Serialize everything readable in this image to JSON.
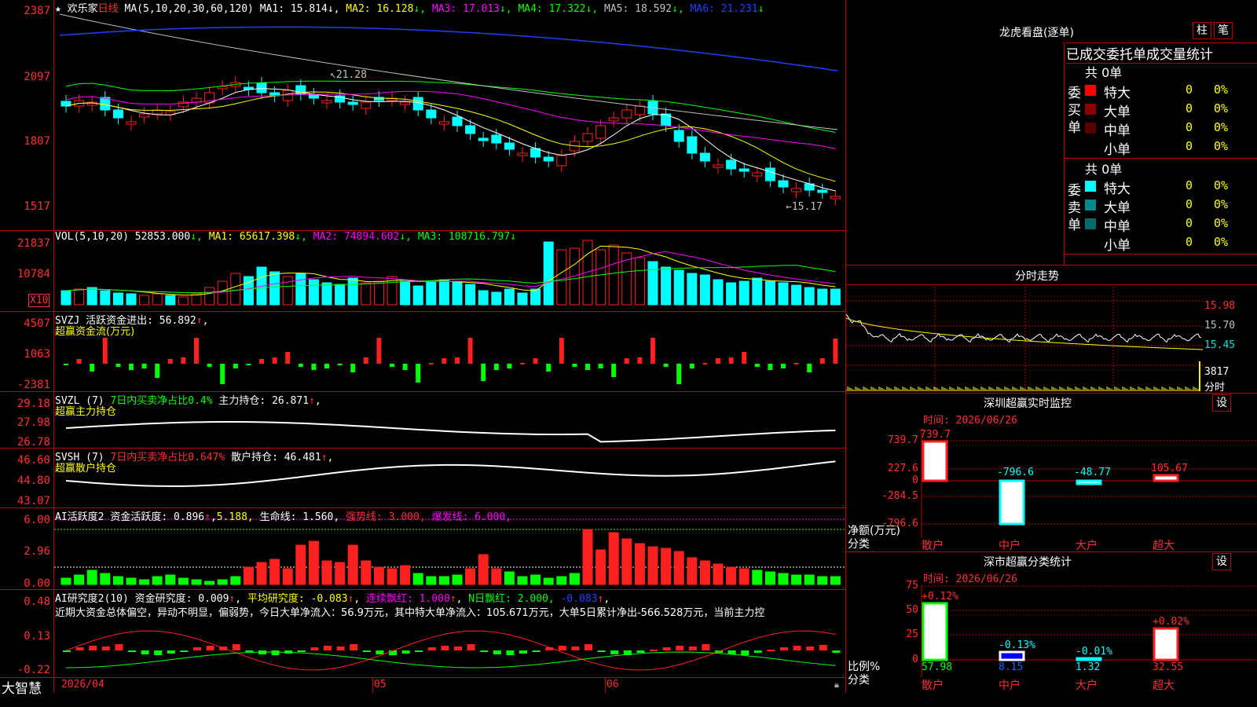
{
  "header": {
    "stock": "欢乐家",
    "period": "日线",
    "ma_label": "MA(5,10,20,30,60,120)",
    "ma1": "MA1: 15.814",
    "ma2": "MA2: 16.128",
    "ma3": "MA3: 17.013",
    "ma4": "MA4: 17.322",
    "ma5": "MA5: 18.592",
    "ma6": "MA6: 21.231",
    "hi_annot": "21.28",
    "lo_annot": "15.17"
  },
  "price_axis": [
    "2387",
    "2097",
    "1807",
    "1517"
  ],
  "vol": {
    "label": "VOL(5,10,20)",
    "value": "52853.000",
    "ma1": "MA1: 65617.398",
    "ma2": "MA2: 74894.602",
    "ma3": "MA3: 108716.797",
    "axis": [
      "21837",
      "10784"
    ],
    "unit": "X10"
  },
  "svzj": {
    "l1a": "SVZJ",
    "l1b": "活跃资金进出: 56.892",
    "l2": "超赢资金流(万元)",
    "axis": [
      "4507",
      "1063",
      "-2381"
    ]
  },
  "svzl": {
    "l1a": "SVZL (7)",
    "l1b": "7日内买卖净占比0.4%",
    "l1c": "主力持仓: 26.871",
    "l2": "超赢主力持仓",
    "axis": [
      "29.18",
      "27.98",
      "26.78"
    ]
  },
  "svsh": {
    "l1a": "SVSH (7)",
    "l1b": "7日内买卖净占比0.647%",
    "l1c": "散户持仓: 46.481",
    "l2": "超赢散户持仓",
    "axis": [
      "46.60",
      "44.80",
      "43.07"
    ]
  },
  "ai2": {
    "a": "AI活跃度2",
    "b": "资金活跃度: 0.896",
    "c": "5.188,",
    "d": "生命线: 1.560,",
    "e": "强势线: 3.000,",
    "f": "爆发线: 6.000,",
    "axis": [
      "6.00",
      "2.96",
      "0.00"
    ]
  },
  "ai3": {
    "a": "AI研究度2(10)",
    "b": "资金研究度: 0.009",
    "c": "平均研究度: -0.083",
    "d": "连续飘红: 1.000",
    "e": "N日飘红: 2.000,",
    "f": "-0.083",
    "text": "近期大资金总体偏空，异动不明显，偏弱势，今日大单净流入：56.9万元，其中特大单净流入：105.671万元，大单5日累计净出-566.528万元，当前主力控",
    "axis": [
      "0.48",
      "0.13",
      "-0.22"
    ]
  },
  "timeaxis": [
    "2026/04",
    "05",
    "06"
  ],
  "brand": "大智慧",
  "dragon": {
    "title": "龙虎看盘(逐单)",
    "btn1": "柱",
    "btn2": "笔",
    "tabs": "已成交委托单成交量统计",
    "buy": {
      "side": "委买单",
      "total": "共 0单",
      "rows": [
        {
          "name": "特大",
          "v": "0",
          "p": "0%",
          "c": "#ff0000"
        },
        {
          "name": "大单",
          "v": "0",
          "p": "0%",
          "c": "#8b0000"
        },
        {
          "name": "中单",
          "v": "0",
          "p": "0%",
          "c": "#5a0000"
        },
        {
          "name": "小单",
          "v": "0",
          "p": "0%",
          "c": "#000000"
        }
      ]
    },
    "sell": {
      "side": "委卖单",
      "total": "共 0单",
      "rows": [
        {
          "name": "特大",
          "v": "0",
          "p": "0%",
          "c": "#00ffff"
        },
        {
          "name": "大单",
          "v": "0",
          "p": "0%",
          "c": "#008b8b"
        },
        {
          "name": "中单",
          "v": "0",
          "p": "0%",
          "c": "#006b6b"
        },
        {
          "name": "小单",
          "v": "0",
          "p": "0%",
          "c": "#000000"
        }
      ]
    }
  },
  "fenshi": {
    "title": "分时走势",
    "axis": [
      "15.98",
      "15.70",
      "15.45"
    ],
    "vol": "3817",
    "unit": "分时"
  },
  "monitor": {
    "title": "深圳超赢实时监控",
    "btn": "设",
    "date": "时间: 2026/06/26",
    "axis": [
      "739.7",
      "227.6",
      "0",
      "-284.5",
      "-796.6"
    ],
    "unit1": "净额(万元)",
    "unit2": "分类",
    "bars": [
      {
        "cat": "散户",
        "v": "739.7"
      },
      {
        "cat": "中户",
        "v": "-796.6"
      },
      {
        "cat": "大户",
        "v": "-48.77"
      },
      {
        "cat": "超大",
        "v": "105.67"
      }
    ]
  },
  "stat": {
    "title": "深市超赢分类统计",
    "btn": "设",
    "date": "时间: 2026/06/26",
    "axis": [
      "75",
      "50",
      "25",
      "0"
    ],
    "unit1": "比例%",
    "unit2": "分类",
    "bars": [
      {
        "cat": "散户",
        "top": "+0.12%",
        "v": "57.98"
      },
      {
        "cat": "中户",
        "top": "-0.13%",
        "v": "8.15"
      },
      {
        "cat": "大户",
        "top": "-0.01%",
        "v": "1.32"
      },
      {
        "cat": "超大",
        "top": "+0.02%",
        "v": "32.55"
      }
    ]
  }
}
